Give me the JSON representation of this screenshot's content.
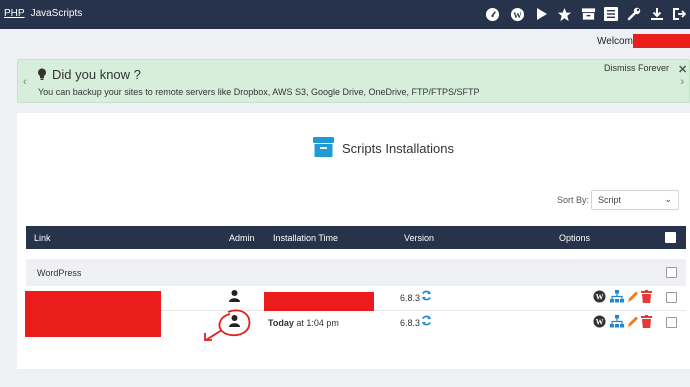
{
  "topbar": {
    "nav": [
      "PHP",
      "JavaScripts"
    ],
    "icons": [
      "dashboard-icon",
      "wordpress-icon",
      "play-icon",
      "star-icon",
      "archive-icon",
      "list-icon",
      "wrench-icon",
      "download-icon",
      "sign-out-icon"
    ]
  },
  "welcome": {
    "label": "Welcome"
  },
  "alert": {
    "title": "Did you know ?",
    "message": "You can backup your sites to remote servers like Dropbox, AWS S3, Google Drive, OneDrive, FTP/FTPS/SFTP",
    "dismiss": "Dismiss Forever",
    "close": "✕",
    "prev": "‹",
    "next": "›"
  },
  "main": {
    "title": "Scripts Installations",
    "sort_label": "Sort By:",
    "sort_value": "Script",
    "columns": [
      "Link",
      "Admin",
      "Installation Time",
      "Version",
      "Options"
    ],
    "group": "WordPress",
    "rows": [
      {
        "time": "",
        "version": "6.8.3"
      },
      {
        "time_bold": "Today",
        "time": " at 1:04 pm",
        "version": "6.8.3"
      }
    ]
  },
  "colors": {
    "topbar": "#27334a",
    "alert_bg": "#d7eedb",
    "redaction": "#ea1c1c",
    "accent_blue": "#1e88d6",
    "edit_orange": "#f07a1a",
    "delete_red": "#e53935"
  }
}
